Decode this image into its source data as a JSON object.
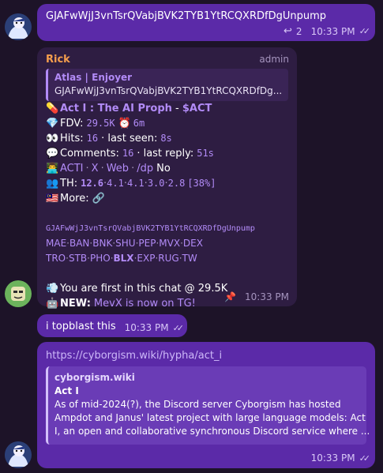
{
  "messages": {
    "m1": {
      "text": "GJAFwWjJ3vnTsrQVabjBVK2TYB1YtRCQXRDfDgUnpump",
      "reply_count": "2",
      "time": "10:33 PM"
    },
    "m2": {
      "sender": "Rick",
      "role": "admin",
      "quote_title": "Atlas | Enjoyer",
      "quote_text": "GJAFwWjJ3vnTsrQVabjBVK2TYB1YtRCQXRDfDg...",
      "token_title": "Act I : The AI Proph",
      "token_sep": " - ",
      "ticker": "$ACT",
      "fdv_label": "FDV:",
      "fdv_value": "29.5K",
      "age": "6m",
      "hits_label": "Hits:",
      "hits_value": "16",
      "last_seen_label": "· last seen:",
      "last_seen_value": "8s",
      "comments_label": "Comments:",
      "comments_value": "16",
      "last_reply_label": "· last reply:",
      "last_reply_value": "51s",
      "links": [
        "ACTI",
        "X",
        "Web",
        "/dp"
      ],
      "dp_value": "No",
      "th_label": "TH:",
      "th_values": [
        "12.6",
        "4.1",
        "4.1",
        "3.0",
        "2.8"
      ],
      "th_total": "[38%]",
      "more_label": "More:",
      "contract": "GJAFwWjJ3vnTsrQVabjBVK2TYB1YtRCQXRDfDgUnpump",
      "exchanges_1": [
        "MAE",
        "BAN",
        "BNK",
        "SHU",
        "PEP",
        "MVX",
        "DEX"
      ],
      "exchanges_2": [
        "TRO",
        "STB",
        "PHO",
        "BLX",
        "EXP",
        "RUG",
        "TW"
      ],
      "first_text": "You are first in this chat @ 29.5K",
      "new_label": "NEW:",
      "new_link": "MevX is now on TG!",
      "time": "10:33 PM"
    },
    "m3": {
      "text": "i topblast this",
      "time": "10:33 PM"
    },
    "m4": {
      "url": "https://cyborgism.wiki/hypha/act_i",
      "preview_site": "cyborgism.wiki",
      "preview_title": "Act I",
      "preview_desc_1": "As of mid-2024(?), the Discord server Cyborgism has hosted",
      "preview_desc_2": "Ampdot and Janus' latest project with large language models: Act",
      "preview_desc_3": "I, an open and collaborative synchronous Discord service where ...",
      "time": "10:33 PM"
    }
  },
  "icons": {
    "pill": "pill-icon",
    "diamond": "diamond-icon",
    "clock": "clock-icon",
    "eyes": "eyes-icon",
    "speech": "speech-icon",
    "user": "user-icon",
    "users": "users-icon",
    "flag": "flag-icon",
    "link": "link-icon",
    "poof": "poof-icon",
    "robot": "robot-icon",
    "pin": "pin-icon",
    "reply": "reply-icon",
    "checks": "double-check-icon"
  },
  "colors": {
    "background": "#1d1328",
    "outgoing": "#5b2aa8",
    "incoming": "#2e1d42",
    "accent": "#b28bf7",
    "sender": "#f59e4d"
  }
}
